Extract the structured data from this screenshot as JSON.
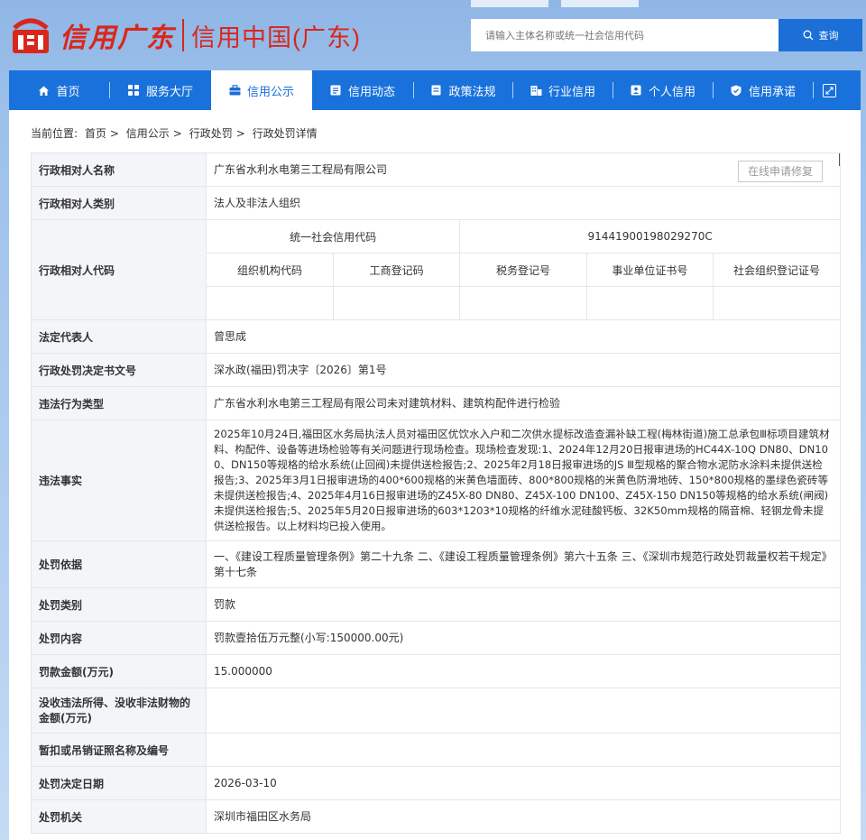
{
  "header": {
    "logo_script": "信用广东",
    "logo_main": "信用中国(广东)",
    "search_placeholder": "请输入主体名称或统一社会信用代码",
    "search_button": "查询"
  },
  "nav": {
    "items": [
      {
        "label": "首页",
        "icon": "home-icon"
      },
      {
        "label": "服务大厅",
        "icon": "grid-icon"
      },
      {
        "label": "信用公示",
        "icon": "briefcase-icon",
        "active": true
      },
      {
        "label": "信用动态",
        "icon": "news-icon"
      },
      {
        "label": "政策法规",
        "icon": "document-icon"
      },
      {
        "label": "行业信用",
        "icon": "building-icon"
      },
      {
        "label": "个人信用",
        "icon": "id-card-icon"
      },
      {
        "label": "信用承诺",
        "icon": "shield-icon"
      }
    ],
    "fullscreen_icon": "expand-icon"
  },
  "breadcrumb": {
    "prefix": "当前位置:",
    "items": [
      "首页",
      ">",
      "信用公示",
      ">",
      "行政处罚",
      ">",
      "行政处罚详情"
    ]
  },
  "detail": {
    "repair_button": "在线申请修复",
    "rows": {
      "name": {
        "label": "行政相对人名称",
        "value": "广东省水利水电第三工程局有限公司"
      },
      "type": {
        "label": "行政相对人类别",
        "value": "法人及非法人组织"
      },
      "code": {
        "label": "行政相对人代码",
        "uscc_label": "统一社会信用代码",
        "uscc_value": "91441900198029270C",
        "sub_headers": [
          "组织机构代码",
          "工商登记码",
          "税务登记号",
          "事业单位证书号",
          "社会组织登记证号"
        ]
      },
      "legal_rep": {
        "label": "法定代表人",
        "value": "曾思成"
      },
      "doc_no": {
        "label": "行政处罚决定书文号",
        "value": "深水政(福田)罚决字〔2026〕第1号"
      },
      "violation_type": {
        "label": "违法行为类型",
        "value": "广东省水利水电第三工程局有限公司未对建筑材料、建筑构配件进行检验"
      },
      "facts": {
        "label": "违法事实",
        "value": "2025年10月24日,福田区水务局执法人员对福田区优饮水入户和二次供水提标改造查漏补缺工程(梅林街道)施工总承包Ⅲ标项目建筑材料、构配件、设备等进场检验等有关问题进行现场检查。现场检查发现:1、2024年12月20日报审进场的HC44X-10Q DN80、DN100、DN150等规格的给水系统(止回阀)未提供送检报告;2、2025年2月18日报审进场的JS Ⅲ型规格的聚合物水泥防水涂料未提供送检报告;3、2025年3月1日报审进场的400*600规格的米黄色墙面砖、800*800规格的米黄色防滑地砖、150*800规格的墨绿色瓷砖等未提供送检报告;4、2025年4月16日报审进场的Z45X-80 DN80、Z45X-100 DN100、Z45X-150 DN150等规格的给水系统(闸阀)未提供送检报告;5、2025年5月20日报审进场的603*1203*10规格的纤维水泥硅酸钙板、32K50mm规格的隔音棉、轻钢龙骨未提供送检报告。以上材料均已投入使用。"
      },
      "basis": {
        "label": "处罚依据",
        "value": "一、《建设工程质量管理条例》第二十九条 二、《建设工程质量管理条例》第六十五条 三、《深圳市规范行政处罚裁量权若干规定》第十七条"
      },
      "category": {
        "label": "处罚类别",
        "value": "罚款"
      },
      "content": {
        "label": "处罚内容",
        "value": "罚款壹拾伍万元整(小写:150000.00元)"
      },
      "amount": {
        "label": "罚款金额(万元)",
        "value": "15.000000"
      },
      "confiscation": {
        "label": "没收违法所得、没收非法财物的金额(万元)",
        "value": ""
      },
      "license": {
        "label": "暂扣或吊销证照名称及编号",
        "value": ""
      },
      "date": {
        "label": "处罚决定日期",
        "value": "2026-03-10"
      },
      "authority": {
        "label": "处罚机关",
        "value": "深圳市福田区水务局"
      }
    }
  },
  "colors": {
    "brand_red": "#d9271c",
    "nav_blue": "#1971dc",
    "search_blue": "#1b6fd6"
  }
}
